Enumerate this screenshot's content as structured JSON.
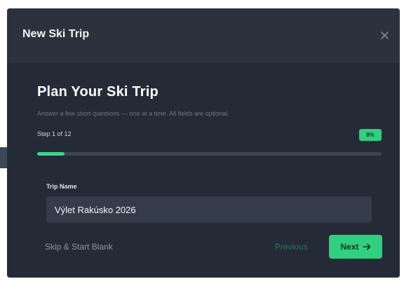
{
  "dialog": {
    "title": "New Ski Trip",
    "close_icon": "close-icon"
  },
  "wizard": {
    "heading": "Plan Your Ski Trip",
    "subtitle": "Answer a few short questions — one at a time. All fields are optional.",
    "step_label": "Step 1 of 12",
    "progress_percent_label": "8%",
    "progress_value": 0.08
  },
  "field": {
    "label": "Trip Name",
    "value": "Výlet Rakúsko 2026"
  },
  "actions": {
    "skip_label": "Skip & Start Blank",
    "previous_label": "Previous",
    "next_label": "Next",
    "next_icon": "arrow-right-icon"
  },
  "colors": {
    "accent": "#2fd07f",
    "dialog_bg": "#252b36",
    "header_bg": "#2b323e",
    "input_bg": "#353c49"
  }
}
